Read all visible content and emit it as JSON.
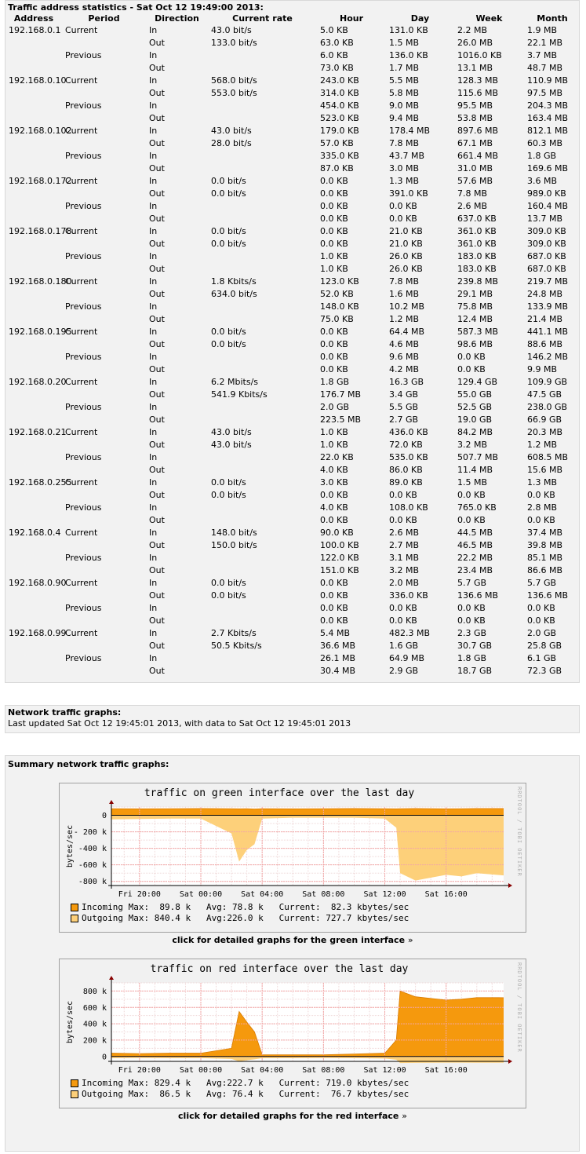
{
  "stats": {
    "title": "Traffic address statistics - Sat Oct 12 19:49:00 2013:",
    "headers": [
      "Address",
      "Period",
      "Direction",
      "Current rate",
      "Hour",
      "Day",
      "Week",
      "Month"
    ],
    "rows": [
      [
        "192.168.0.1",
        "Current",
        "In",
        "43.0 bit/s",
        "5.0 KB",
        "131.0 KB",
        "2.2 MB",
        "1.9 MB"
      ],
      [
        "",
        "",
        "Out",
        "133.0 bit/s",
        "63.0 KB",
        "1.5 MB",
        "26.0 MB",
        "22.1 MB"
      ],
      [
        "",
        "Previous",
        "In",
        "",
        "6.0 KB",
        "136.0 KB",
        "1016.0 KB",
        "3.7 MB"
      ],
      [
        "",
        "",
        "Out",
        "",
        "73.0 KB",
        "1.7 MB",
        "13.1 MB",
        "48.7 MB"
      ],
      [
        "192.168.0.10",
        "Current",
        "In",
        "568.0 bit/s",
        "243.0 KB",
        "5.5 MB",
        "128.3 MB",
        "110.9 MB"
      ],
      [
        "",
        "",
        "Out",
        "553.0 bit/s",
        "314.0 KB",
        "5.8 MB",
        "115.6 MB",
        "97.5 MB"
      ],
      [
        "",
        "Previous",
        "In",
        "",
        "454.0 KB",
        "9.0 MB",
        "95.5 MB",
        "204.3 MB"
      ],
      [
        "",
        "",
        "Out",
        "",
        "523.0 KB",
        "9.4 MB",
        "53.8 MB",
        "163.4 MB"
      ],
      [
        "192.168.0.102",
        "Current",
        "In",
        "43.0 bit/s",
        "179.0 KB",
        "178.4 MB",
        "897.6 MB",
        "812.1 MB"
      ],
      [
        "",
        "",
        "Out",
        "28.0 bit/s",
        "57.0 KB",
        "7.8 MB",
        "67.1 MB",
        "60.3 MB"
      ],
      [
        "",
        "Previous",
        "In",
        "",
        "335.0 KB",
        "43.7 MB",
        "661.4 MB",
        "1.8 GB"
      ],
      [
        "",
        "",
        "Out",
        "",
        "87.0 KB",
        "3.0 MB",
        "31.0 MB",
        "169.6 MB"
      ],
      [
        "192.168.0.172",
        "Current",
        "In",
        "0.0 bit/s",
        "0.0 KB",
        "1.3 MB",
        "57.6 MB",
        "3.6 MB"
      ],
      [
        "",
        "",
        "Out",
        "0.0 bit/s",
        "0.0 KB",
        "391.0 KB",
        "7.8 MB",
        "989.0 KB"
      ],
      [
        "",
        "Previous",
        "In",
        "",
        "0.0 KB",
        "0.0 KB",
        "2.6 MB",
        "160.4 MB"
      ],
      [
        "",
        "",
        "Out",
        "",
        "0.0 KB",
        "0.0 KB",
        "637.0 KB",
        "13.7 MB"
      ],
      [
        "192.168.0.178",
        "Current",
        "In",
        "0.0 bit/s",
        "0.0 KB",
        "21.0 KB",
        "361.0 KB",
        "309.0 KB"
      ],
      [
        "",
        "",
        "Out",
        "0.0 bit/s",
        "0.0 KB",
        "21.0 KB",
        "361.0 KB",
        "309.0 KB"
      ],
      [
        "",
        "Previous",
        "In",
        "",
        "1.0 KB",
        "26.0 KB",
        "183.0 KB",
        "687.0 KB"
      ],
      [
        "",
        "",
        "Out",
        "",
        "1.0 KB",
        "26.0 KB",
        "183.0 KB",
        "687.0 KB"
      ],
      [
        "192.168.0.180",
        "Current",
        "In",
        "1.8 Kbits/s",
        "123.0 KB",
        "7.8 MB",
        "239.8 MB",
        "219.7 MB"
      ],
      [
        "",
        "",
        "Out",
        "634.0 bit/s",
        "52.0 KB",
        "1.6 MB",
        "29.1 MB",
        "24.8 MB"
      ],
      [
        "",
        "Previous",
        "In",
        "",
        "148.0 KB",
        "10.2 MB",
        "75.8 MB",
        "133.9 MB"
      ],
      [
        "",
        "",
        "Out",
        "",
        "75.0 KB",
        "1.2 MB",
        "12.4 MB",
        "21.4 MB"
      ],
      [
        "192.168.0.195",
        "Current",
        "In",
        "0.0 bit/s",
        "0.0 KB",
        "64.4 MB",
        "587.3 MB",
        "441.1 MB"
      ],
      [
        "",
        "",
        "Out",
        "0.0 bit/s",
        "0.0 KB",
        "4.6 MB",
        "98.6 MB",
        "88.6 MB"
      ],
      [
        "",
        "Previous",
        "In",
        "",
        "0.0 KB",
        "9.6 MB",
        "0.0 KB",
        "146.2 MB"
      ],
      [
        "",
        "",
        "Out",
        "",
        "0.0 KB",
        "4.2 MB",
        "0.0 KB",
        "9.9 MB"
      ],
      [
        "192.168.0.20",
        "Current",
        "In",
        "6.2 Mbits/s",
        "1.8 GB",
        "16.3 GB",
        "129.4 GB",
        "109.9 GB"
      ],
      [
        "",
        "",
        "Out",
        "541.9 Kbits/s",
        "176.7 MB",
        "3.4 GB",
        "55.0 GB",
        "47.5 GB"
      ],
      [
        "",
        "Previous",
        "In",
        "",
        "2.0 GB",
        "5.5 GB",
        "52.5 GB",
        "238.0 GB"
      ],
      [
        "",
        "",
        "Out",
        "",
        "223.5 MB",
        "2.7 GB",
        "19.0 GB",
        "66.9 GB"
      ],
      [
        "192.168.0.21",
        "Current",
        "In",
        "43.0 bit/s",
        "1.0 KB",
        "436.0 KB",
        "84.2 MB",
        "20.3 MB"
      ],
      [
        "",
        "",
        "Out",
        "43.0 bit/s",
        "1.0 KB",
        "72.0 KB",
        "3.2 MB",
        "1.2 MB"
      ],
      [
        "",
        "Previous",
        "In",
        "",
        "22.0 KB",
        "535.0 KB",
        "507.7 MB",
        "608.5 MB"
      ],
      [
        "",
        "",
        "Out",
        "",
        "4.0 KB",
        "86.0 KB",
        "11.4 MB",
        "15.6 MB"
      ],
      [
        "192.168.0.255",
        "Current",
        "In",
        "0.0 bit/s",
        "3.0 KB",
        "89.0 KB",
        "1.5 MB",
        "1.3 MB"
      ],
      [
        "",
        "",
        "Out",
        "0.0 bit/s",
        "0.0 KB",
        "0.0 KB",
        "0.0 KB",
        "0.0 KB"
      ],
      [
        "",
        "Previous",
        "In",
        "",
        "4.0 KB",
        "108.0 KB",
        "765.0 KB",
        "2.8 MB"
      ],
      [
        "",
        "",
        "Out",
        "",
        "0.0 KB",
        "0.0 KB",
        "0.0 KB",
        "0.0 KB"
      ],
      [
        "192.168.0.4",
        "Current",
        "In",
        "148.0 bit/s",
        "90.0 KB",
        "2.6 MB",
        "44.5 MB",
        "37.4 MB"
      ],
      [
        "",
        "",
        "Out",
        "150.0 bit/s",
        "100.0 KB",
        "2.7 MB",
        "46.5 MB",
        "39.8 MB"
      ],
      [
        "",
        "Previous",
        "In",
        "",
        "122.0 KB",
        "3.1 MB",
        "22.2 MB",
        "85.1 MB"
      ],
      [
        "",
        "",
        "Out",
        "",
        "151.0 KB",
        "3.2 MB",
        "23.4 MB",
        "86.6 MB"
      ],
      [
        "192.168.0.90",
        "Current",
        "In",
        "0.0 bit/s",
        "0.0 KB",
        "2.0 MB",
        "5.7 GB",
        "5.7 GB"
      ],
      [
        "",
        "",
        "Out",
        "0.0 bit/s",
        "0.0 KB",
        "336.0 KB",
        "136.6 MB",
        "136.6 MB"
      ],
      [
        "",
        "Previous",
        "In",
        "",
        "0.0 KB",
        "0.0 KB",
        "0.0 KB",
        "0.0 KB"
      ],
      [
        "",
        "",
        "Out",
        "",
        "0.0 KB",
        "0.0 KB",
        "0.0 KB",
        "0.0 KB"
      ],
      [
        "192.168.0.99",
        "Current",
        "In",
        "2.7 Kbits/s",
        "5.4 MB",
        "482.3 MB",
        "2.3 GB",
        "2.0 GB"
      ],
      [
        "",
        "",
        "Out",
        "50.5 Kbits/s",
        "36.6 MB",
        "1.6 GB",
        "30.7 GB",
        "25.8 GB"
      ],
      [
        "",
        "Previous",
        "In",
        "",
        "26.1 MB",
        "64.9 MB",
        "1.8 GB",
        "6.1 GB"
      ],
      [
        "",
        "",
        "Out",
        "",
        "30.4 MB",
        "2.9 GB",
        "18.7 GB",
        "72.3 GB"
      ]
    ]
  },
  "network_graphs": {
    "title": "Network traffic graphs:",
    "updated": "Last updated Sat Oct 12 19:45:01 2013, with data to Sat Oct 12 19:45:01 2013"
  },
  "summary": {
    "title": "Summary network traffic graphs:",
    "rrd_credit": "RRDTOOL / TOBI OETIKER",
    "colors": {
      "incoming": "#f5990d",
      "outgoing": "#fdd07a",
      "incoming_line": "#d97a00",
      "grid_major": "#f3a6a6",
      "grid_minor": "#efd8d8",
      "plot_bg": "#ffffff"
    },
    "green": {
      "title": "traffic on green interface over the last day",
      "ylabel": "bytes/sec",
      "yticks": [
        "0",
        "- 200 k",
        "-400 k",
        "-600 k",
        "-800 k"
      ],
      "xticks": [
        "Fri 20:00",
        "Sat 00:00",
        "Sat 04:00",
        "Sat 08:00",
        "Sat 12:00",
        "Sat 16:00"
      ],
      "legend": [
        {
          "label": "Incoming",
          "max": "89.8 k",
          "avg": "78.8 k",
          "current": "82.3 kbytes/sec"
        },
        {
          "label": "Outgoing",
          "max": "840.4 k",
          "avg": "226.0 k",
          "current": "727.7 kbytes/sec"
        }
      ],
      "link": "click for detailed graphs for the green interface",
      "link_arrow": "»"
    },
    "red": {
      "title": "traffic on red interface over the last day",
      "ylabel": "bytes/sec",
      "yticks": [
        "800 k",
        "600 k",
        "400 k",
        "200 k",
        "0"
      ],
      "xticks": [
        "Fri 20:00",
        "Sat 00:00",
        "Sat 04:00",
        "Sat 08:00",
        "Sat 12:00",
        "Sat 16:00"
      ],
      "legend": [
        {
          "label": "Incoming",
          "max": "829.4 k",
          "avg": "222.7 k",
          "current": "719.0 kbytes/sec"
        },
        {
          "label": "Outgoing",
          "max": "86.5 k",
          "avg": "76.4 k",
          "current": "76.7 kbytes/sec"
        }
      ],
      "link": "click for detailed graphs for the red interface",
      "link_arrow": "»"
    }
  },
  "chart_data": [
    {
      "type": "area",
      "title": "traffic on green interface over the last day",
      "ylabel": "bytes/sec",
      "ylim": [
        -850,
        100
      ],
      "yunit": "k",
      "x": [
        "Fri 18:10",
        "Fri 20:00",
        "Fri 22:00",
        "Sat 00:00",
        "Sat 02:00",
        "Sat 02:30",
        "Sat 03:00",
        "Sat 03:30",
        "Sat 04:00",
        "Sat 06:00",
        "Sat 08:00",
        "Sat 10:00",
        "Sat 12:00",
        "Sat 12:45",
        "Sat 13:00",
        "Sat 14:00",
        "Sat 16:00",
        "Sat 17:00",
        "Sat 18:00",
        "Sat 19:45"
      ],
      "series": [
        {
          "name": "Incoming",
          "values": [
            80,
            78,
            80,
            82,
            80,
            78,
            80,
            76,
            80,
            78,
            80,
            82,
            80,
            78,
            80,
            82,
            78,
            80,
            82,
            82
          ]
        },
        {
          "name": "Outgoing",
          "values": [
            -50,
            -45,
            -40,
            -40,
            -220,
            -560,
            -420,
            -350,
            -40,
            -30,
            -30,
            -30,
            -40,
            -150,
            -700,
            -790,
            -720,
            -740,
            -700,
            -728
          ]
        }
      ]
    },
    {
      "type": "area",
      "title": "traffic on red interface over the last day",
      "ylabel": "bytes/sec",
      "ylim": [
        -60,
        900
      ],
      "yunit": "k",
      "x": [
        "Fri 18:10",
        "Fri 20:00",
        "Fri 22:00",
        "Sat 00:00",
        "Sat 02:00",
        "Sat 02:30",
        "Sat 03:00",
        "Sat 03:30",
        "Sat 04:00",
        "Sat 06:00",
        "Sat 08:00",
        "Sat 10:00",
        "Sat 12:00",
        "Sat 12:45",
        "Sat 13:00",
        "Sat 14:00",
        "Sat 16:00",
        "Sat 17:00",
        "Sat 18:00",
        "Sat 19:45"
      ],
      "series": [
        {
          "name": "Incoming",
          "values": [
            40,
            35,
            40,
            40,
            100,
            550,
            420,
            300,
            20,
            20,
            20,
            30,
            40,
            200,
            800,
            730,
            690,
            700,
            720,
            719
          ]
        },
        {
          "name": "Outgoing",
          "values": [
            -20,
            -18,
            -20,
            -20,
            -30,
            -60,
            -45,
            -35,
            -20,
            -20,
            -18,
            -20,
            -25,
            -40,
            -80,
            -78,
            -75,
            -76,
            -77,
            -77
          ]
        }
      ]
    }
  ]
}
